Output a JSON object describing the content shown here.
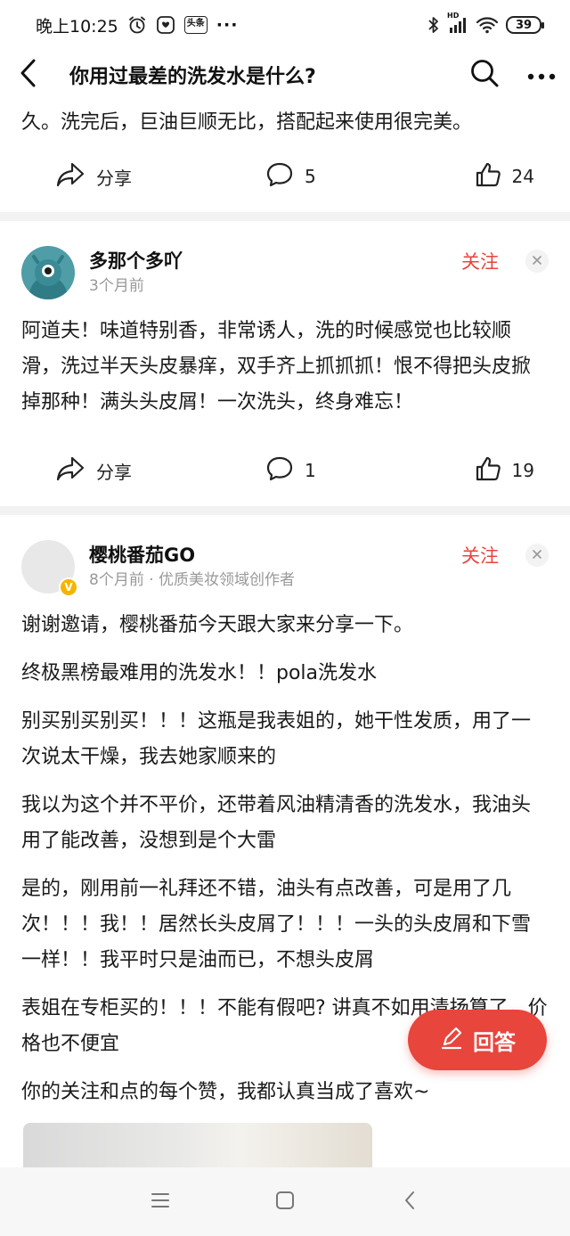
{
  "status_bar": {
    "time": "晚上10:25",
    "badge": "头条",
    "more": "···",
    "network": "HD",
    "battery": "39"
  },
  "header": {
    "title": "你用过最差的洗发水是什么?"
  },
  "first_answer_tail": {
    "text": "久。洗完后，巨油巨顺无比，搭配起来使用很完美。",
    "share_label": "分享",
    "comment_count": "5",
    "like_count": "24"
  },
  "answer2": {
    "author": "多那个多吖",
    "meta": "3个月前",
    "follow_label": "关注",
    "body": "阿道夫！味道特别香，非常诱人，洗的时候感觉也比较顺滑，洗过半天头皮暴痒，双手齐上抓抓抓！恨不得把头皮掀掉那种！满头头皮屑！一次洗头，终身难忘！",
    "share_label": "分享",
    "comment_count": "1",
    "like_count": "19"
  },
  "answer3": {
    "author": "樱桃番茄GO",
    "meta": "8个月前 · 优质美妆领域创作者",
    "follow_label": "关注",
    "paragraphs": [
      "谢谢邀请，樱桃番茄今天跟大家来分享一下。",
      "终极黑榜最难用的洗发水！！pola洗发水",
      "别买别买别买！！！这瓶是我表姐的，她干性发质，用了一次说太干燥，我去她家顺来的",
      "我以为这个并不平价，还带着风油精清香的洗发水，我油头用了能改善，没想到是个大雷",
      "是的，刚用前一礼拜还不错，油头有点改善，可是用了几次！！！我！！居然长头皮屑了！！！一头的头皮屑和下雪一样！！我平时只是油而已，不想头皮屑",
      "表姐在专柜买的！！！不能有假吧? 讲真不如用清扬算了，价格也不便宜",
      "你的关注和点的每个赞，我都认真当成了喜欢~"
    ]
  },
  "fab": {
    "label": "回答"
  },
  "colors": {
    "accent": "#e8453c",
    "text": "#1a1a1a",
    "meta": "#999999",
    "divider": "#f2f2f2"
  },
  "icons": [
    "back-arrow-icon",
    "search-icon",
    "more-icon",
    "share-icon",
    "comment-icon",
    "like-icon",
    "close-icon",
    "pen-icon",
    "menu-icon",
    "home-icon",
    "nav-back-icon"
  ]
}
